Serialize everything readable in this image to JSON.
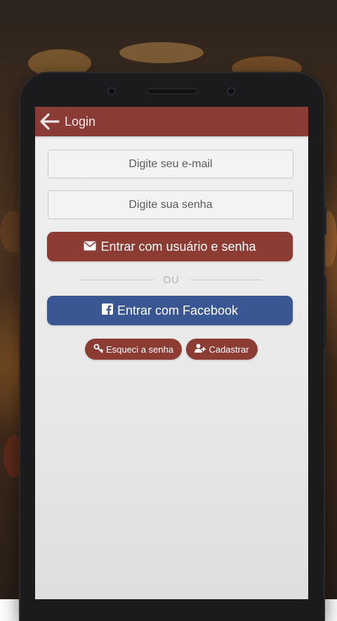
{
  "appbar": {
    "title": "Login",
    "back_icon": "arrow-left-icon"
  },
  "form": {
    "email_placeholder": "Digite seu e-mail",
    "password_placeholder": "Digite sua senha",
    "login_button_label": "Entrar com usuário e senha",
    "login_button_icon": "envelope-icon",
    "divider_text": "OU",
    "facebook_button_label": "Entrar com Facebook",
    "facebook_button_icon": "facebook-icon",
    "forgot_button_label": "Esqueci a senha",
    "forgot_button_icon": "key-icon",
    "register_button_label": "Cadastrar",
    "register_button_icon": "user-plus-icon"
  },
  "colors": {
    "primary": "#8d3c34",
    "facebook": "#3a5793",
    "screen_bg": "#ececec"
  }
}
